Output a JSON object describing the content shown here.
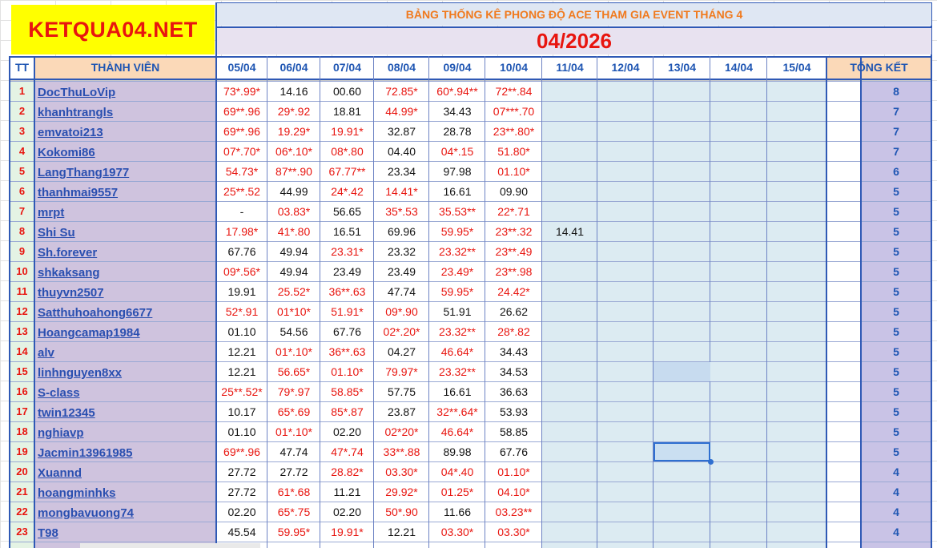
{
  "logo": "KETQUA04.NET",
  "title": "BẢNG THỐNG KÊ PHONG ĐỘ ACE THAM GIA EVENT THÁNG 4",
  "month": "04/2026",
  "headers": {
    "tt": "TT",
    "member": "THÀNH VIÊN",
    "dates": [
      "05/04",
      "06/04",
      "07/04",
      "08/04",
      "09/04",
      "10/04",
      "11/04",
      "12/04",
      "13/04",
      "14/04",
      "15/04"
    ],
    "total": "TỔNG KẾT"
  },
  "colors": {
    "red": "#e8150f",
    "blue_text": "#1f56b3",
    "name_col_bg": "#cfc3de",
    "tt_col_bg": "#e4f3e4",
    "empty_col_bg": "#dcebf2",
    "total_col_bg": "#c9c3e6",
    "logo_bg": "#ffff00",
    "title_orange": "#f07a1e"
  },
  "rows": [
    {
      "tt": "1",
      "name": "DocThuLoVip",
      "cells": [
        [
          "73*.99*",
          "r"
        ],
        [
          "14.16",
          "k"
        ],
        [
          "00.60",
          "k"
        ],
        [
          "72.85*",
          "r"
        ],
        [
          "60*.94**",
          "r"
        ],
        [
          "72**.84",
          "r"
        ],
        [
          "",
          ""
        ]
      ],
      "total": "8"
    },
    {
      "tt": "2",
      "name": "khanhtrangls",
      "cells": [
        [
          "69**.96",
          "r"
        ],
        [
          "29*.92",
          "r"
        ],
        [
          "18.81",
          "k"
        ],
        [
          "44.99*",
          "r"
        ],
        [
          "34.43",
          "k"
        ],
        [
          "07***.70",
          "r"
        ],
        [
          "",
          ""
        ]
      ],
      "total": "7"
    },
    {
      "tt": "3",
      "name": "emvatoi213",
      "cells": [
        [
          "69**.96",
          "r"
        ],
        [
          "19.29*",
          "r"
        ],
        [
          "19.91*",
          "r"
        ],
        [
          "32.87",
          "k"
        ],
        [
          "28.78",
          "k"
        ],
        [
          "23**.80*",
          "r"
        ],
        [
          "",
          ""
        ]
      ],
      "total": "7"
    },
    {
      "tt": "4",
      "name": "Kokomi86",
      "cells": [
        [
          "07*.70*",
          "r"
        ],
        [
          "06*.10*",
          "r"
        ],
        [
          "08*.80",
          "r"
        ],
        [
          "04.40",
          "k"
        ],
        [
          "04*.15",
          "r"
        ],
        [
          "51.80*",
          "r"
        ],
        [
          "",
          ""
        ]
      ],
      "total": "7"
    },
    {
      "tt": "5",
      "name": "LangThang1977",
      "cells": [
        [
          "54.73*",
          "r"
        ],
        [
          "87**.90",
          "r"
        ],
        [
          "67.77**",
          "r"
        ],
        [
          "23.34",
          "k"
        ],
        [
          "97.98",
          "k"
        ],
        [
          "01.10*",
          "r"
        ],
        [
          "",
          ""
        ]
      ],
      "total": "6"
    },
    {
      "tt": "6",
      "name": "thanhmai9557",
      "cells": [
        [
          "25**.52",
          "r"
        ],
        [
          "44.99",
          "k"
        ],
        [
          "24*.42",
          "r"
        ],
        [
          "14.41*",
          "r"
        ],
        [
          "16.61",
          "k"
        ],
        [
          "09.90",
          "k"
        ],
        [
          "",
          ""
        ]
      ],
      "total": "5"
    },
    {
      "tt": "7",
      "name": "mrpt",
      "cells": [
        [
          "-",
          "k"
        ],
        [
          "03.83*",
          "r"
        ],
        [
          "56.65",
          "k"
        ],
        [
          "35*.53",
          "r"
        ],
        [
          "35.53**",
          "r"
        ],
        [
          "22*.71",
          "r"
        ],
        [
          "",
          ""
        ]
      ],
      "total": "5"
    },
    {
      "tt": "8",
      "name": "Shi Su",
      "cells": [
        [
          "17.98*",
          "r"
        ],
        [
          "41*.80",
          "r"
        ],
        [
          "16.51",
          "k"
        ],
        [
          "69.96",
          "k"
        ],
        [
          "59.95*",
          "r"
        ],
        [
          "23**.32",
          "r"
        ],
        [
          "14.41",
          "k"
        ]
      ],
      "total": "5"
    },
    {
      "tt": "9",
      "name": "Sh.forever",
      "cells": [
        [
          "67.76",
          "k"
        ],
        [
          "49.94",
          "k"
        ],
        [
          "23.31*",
          "r"
        ],
        [
          "23.32",
          "k"
        ],
        [
          "23.32**",
          "r"
        ],
        [
          "23**.49",
          "r"
        ],
        [
          "",
          ""
        ]
      ],
      "total": "5"
    },
    {
      "tt": "10",
      "name": "shkaksang",
      "cells": [
        [
          "09*.56*",
          "r"
        ],
        [
          "49.94",
          "k"
        ],
        [
          "23.49",
          "k"
        ],
        [
          "23.49",
          "k"
        ],
        [
          "23.49*",
          "r"
        ],
        [
          "23**.98",
          "r"
        ],
        [
          "",
          ""
        ]
      ],
      "total": "5"
    },
    {
      "tt": "11",
      "name": "thuyvn2507",
      "cells": [
        [
          "19.91",
          "k"
        ],
        [
          "25.52*",
          "r"
        ],
        [
          "36**.63",
          "r"
        ],
        [
          "47.74",
          "k"
        ],
        [
          "59.95*",
          "r"
        ],
        [
          "24.42*",
          "r"
        ],
        [
          "",
          ""
        ]
      ],
      "total": "5"
    },
    {
      "tt": "12",
      "name": "Satthuhoahong6677",
      "cells": [
        [
          "52*.91",
          "r"
        ],
        [
          "01*10*",
          "r"
        ],
        [
          "51.91*",
          "r"
        ],
        [
          "09*.90",
          "r"
        ],
        [
          "51.91",
          "k"
        ],
        [
          "26.62",
          "k"
        ],
        [
          "",
          ""
        ]
      ],
      "total": "5"
    },
    {
      "tt": "13",
      "name": "Hoangcamap1984",
      "cells": [
        [
          "01.10",
          "k"
        ],
        [
          "54.56",
          "k"
        ],
        [
          "67.76",
          "k"
        ],
        [
          "02*.20*",
          "r"
        ],
        [
          "23.32**",
          "r"
        ],
        [
          "28*.82",
          "r"
        ],
        [
          "",
          ""
        ]
      ],
      "total": "5"
    },
    {
      "tt": "14",
      "name": "alv",
      "cells": [
        [
          "12.21",
          "k"
        ],
        [
          "01*.10*",
          "r"
        ],
        [
          "36**.63",
          "r"
        ],
        [
          "04.27",
          "k"
        ],
        [
          "46.64*",
          "r"
        ],
        [
          "34.43",
          "k"
        ],
        [
          "",
          ""
        ]
      ],
      "total": "5"
    },
    {
      "tt": "15",
      "name": "linhnguyen8xx",
      "cells": [
        [
          "12.21",
          "k"
        ],
        [
          "56.65*",
          "r"
        ],
        [
          "01.10*",
          "r"
        ],
        [
          "79.97*",
          "r"
        ],
        [
          "23.32**",
          "r"
        ],
        [
          "34.53",
          "k"
        ],
        [
          "",
          ""
        ]
      ],
      "total": "5"
    },
    {
      "tt": "16",
      "name": "S-class",
      "cells": [
        [
          "25**.52*",
          "r"
        ],
        [
          "79*.97",
          "r"
        ],
        [
          "58.85*",
          "r"
        ],
        [
          "57.75",
          "k"
        ],
        [
          "16.61",
          "k"
        ],
        [
          "36.63",
          "k"
        ],
        [
          "",
          ""
        ]
      ],
      "total": "5"
    },
    {
      "tt": "17",
      "name": "twin12345",
      "cells": [
        [
          "10.17",
          "k"
        ],
        [
          "65*.69",
          "r"
        ],
        [
          "85*.87",
          "r"
        ],
        [
          "23.87",
          "k"
        ],
        [
          "32**.64*",
          "r"
        ],
        [
          "53.93",
          "k"
        ],
        [
          "",
          ""
        ]
      ],
      "total": "5"
    },
    {
      "tt": "18",
      "name": "nghiavp",
      "cells": [
        [
          "01.10",
          "k"
        ],
        [
          "01*.10*",
          "r"
        ],
        [
          "02.20",
          "k"
        ],
        [
          "02*20*",
          "r"
        ],
        [
          "46.64*",
          "r"
        ],
        [
          "58.85",
          "k"
        ],
        [
          "",
          ""
        ]
      ],
      "total": "5"
    },
    {
      "tt": "19",
      "name": "Jacmin13961985",
      "cells": [
        [
          "69**.96",
          "r"
        ],
        [
          "47.74",
          "k"
        ],
        [
          "47*.74",
          "r"
        ],
        [
          "33**.88",
          "r"
        ],
        [
          "89.98",
          "k"
        ],
        [
          "67.76",
          "k"
        ],
        [
          "",
          ""
        ]
      ],
      "total": "5"
    },
    {
      "tt": "20",
      "name": "Xuannd",
      "cells": [
        [
          "27.72",
          "k"
        ],
        [
          "27.72",
          "k"
        ],
        [
          "28.82*",
          "r"
        ],
        [
          "03.30*",
          "r"
        ],
        [
          "04*.40",
          "r"
        ],
        [
          "01.10*",
          "r"
        ],
        [
          "",
          ""
        ]
      ],
      "total": "4"
    },
    {
      "tt": "21",
      "name": "hoangminhks",
      "cells": [
        [
          "27.72",
          "k"
        ],
        [
          "61*.68",
          "r"
        ],
        [
          "11.21",
          "k"
        ],
        [
          "29.92*",
          "r"
        ],
        [
          "01.25*",
          "r"
        ],
        [
          "04.10*",
          "r"
        ],
        [
          "",
          ""
        ]
      ],
      "total": "4"
    },
    {
      "tt": "22",
      "name": "mongbavuong74",
      "cells": [
        [
          "02.20",
          "k"
        ],
        [
          "65*.75",
          "r"
        ],
        [
          "02.20",
          "k"
        ],
        [
          "50*.90",
          "r"
        ],
        [
          "11.66",
          "k"
        ],
        [
          "03.23**",
          "r"
        ],
        [
          "",
          ""
        ]
      ],
      "total": "4"
    },
    {
      "tt": "23",
      "name": "T98",
      "cells": [
        [
          "45.54",
          "k"
        ],
        [
          "59.95*",
          "r"
        ],
        [
          "19.91*",
          "r"
        ],
        [
          "12.21",
          "k"
        ],
        [
          "03.30*",
          "r"
        ],
        [
          "03.30*",
          "r"
        ],
        [
          "",
          ""
        ]
      ],
      "total": "4"
    }
  ]
}
